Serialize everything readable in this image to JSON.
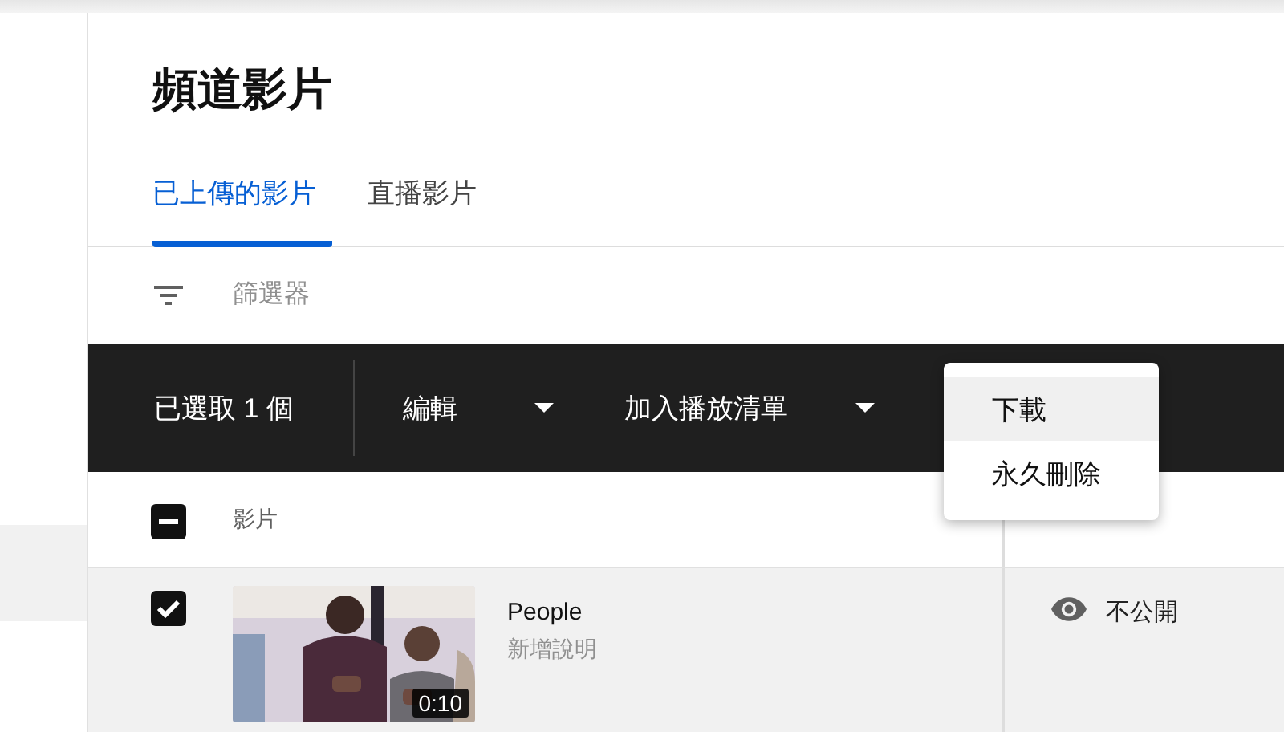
{
  "page_title": "頻道影片",
  "tabs": [
    {
      "label": "已上傳的影片",
      "selected": true
    },
    {
      "label": "直播影片",
      "selected": false
    }
  ],
  "filter": {
    "placeholder": "篩選器"
  },
  "selection_bar": {
    "count": "已選取 1 個",
    "actions": [
      "編輯",
      "加入播放清單"
    ]
  },
  "menu": {
    "items": [
      {
        "label": "下載",
        "highlighted": true
      },
      {
        "label": "永久刪除",
        "highlighted": false
      }
    ]
  },
  "table": {
    "select_all": {
      "checked": false,
      "indeterminate": true
    },
    "columns": [
      "影片"
    ],
    "rows": [
      {
        "selected": true,
        "title": "People",
        "description": "新增說明",
        "duration": "0:10",
        "visibility": "不公開"
      }
    ]
  }
}
